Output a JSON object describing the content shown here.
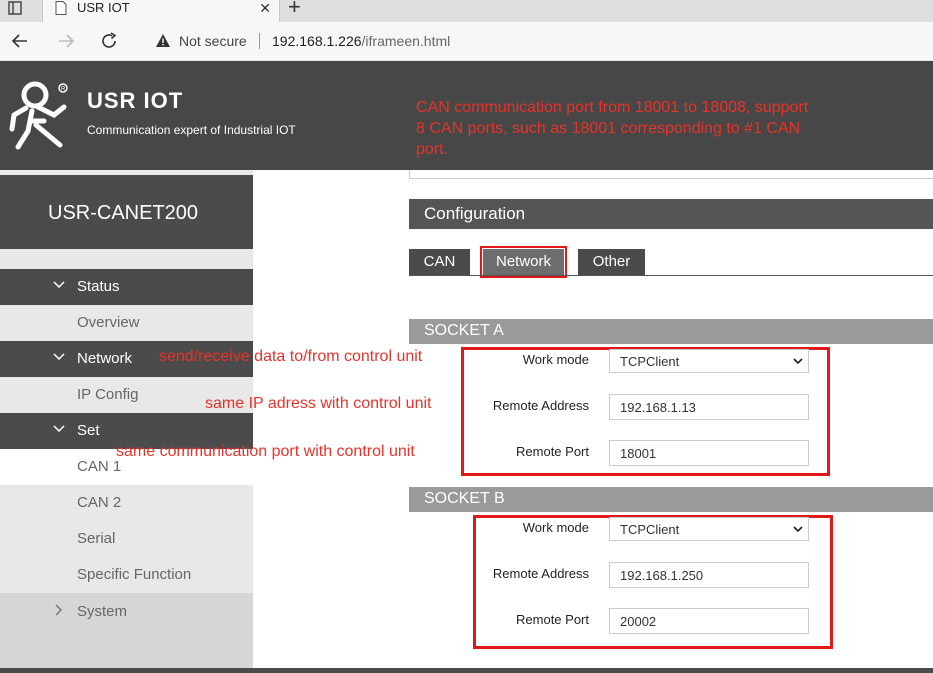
{
  "browser": {
    "tab_title": "USR IOT",
    "tab_close": "✕",
    "new_tab": "+",
    "security_label": "Not secure",
    "url_host": "192.168.1.226",
    "url_path": "/iframeen.html"
  },
  "header": {
    "brand": "USR IOT",
    "tagline": "Communication expert of Industrial IOT",
    "annotation": "CAN communication port from 18001 to 18008, support 8 CAN ports, such as 18001 corresponding to #1 CAN port."
  },
  "sidebar": {
    "product": "USR-CANET200",
    "status": "Status",
    "overview": "Overview",
    "network": "Network",
    "ip_config": "IP Config",
    "set": "Set",
    "can1": "CAN 1",
    "can2": "CAN 2",
    "serial": "Serial",
    "specific": "Specific Function",
    "system": "System"
  },
  "main": {
    "configuration": "Configuration",
    "tabs": [
      "CAN",
      "Network",
      "Other"
    ],
    "socket_a": {
      "title": "SOCKET A",
      "work_mode_label": "Work mode",
      "work_mode": "TCPClient",
      "remote_address_label": "Remote Address",
      "remote_address": "192.168.1.13",
      "remote_port_label": "Remote Port",
      "remote_port": "18001"
    },
    "socket_b": {
      "title": "SOCKET B",
      "work_mode_label": "Work mode",
      "work_mode": "TCPClient",
      "remote_address_label": "Remote Address",
      "remote_address": "192.168.1.250",
      "remote_port_label": "Remote Port",
      "remote_port": "20002"
    }
  },
  "annotations": {
    "send_receive": "send/receive data to/from control unit",
    "same_ip": "same IP adress with control unit",
    "same_port": "same communication port with control unit"
  },
  "colors": {
    "annotation_red": "#e8322a",
    "highlight_red": "#e01818",
    "header_bg": "#474747"
  }
}
